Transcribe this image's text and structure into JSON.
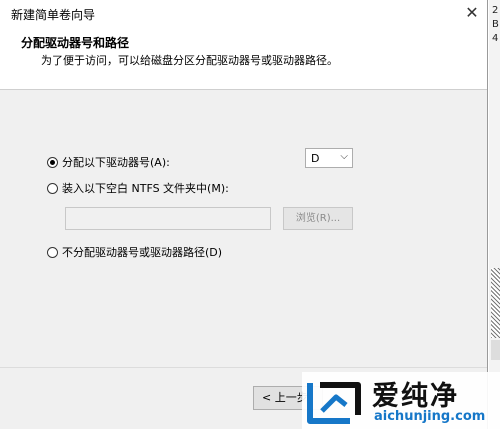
{
  "window": {
    "title": "新建简单卷向导",
    "close_glyph": "✕"
  },
  "header": {
    "title": "分配驱动器号和路径",
    "subtitle": "为了便于访问，可以给磁盘分区分配驱动器号或驱动器路径。"
  },
  "options": {
    "assign_letter": {
      "label": "分配以下驱动器号(A):",
      "checked": true
    },
    "mount_folder": {
      "label": "装入以下空白 NTFS 文件夹中(M):",
      "checked": false
    },
    "no_assign": {
      "label": "不分配驱动器号或驱动器路径(D)",
      "checked": false
    }
  },
  "drive_select": {
    "value": "D",
    "arrow_glyph": "⌵"
  },
  "path_input": {
    "value": ""
  },
  "browse_button": {
    "label": "浏览(R)..."
  },
  "footer": {
    "back_label": "< 上一步"
  },
  "background": {
    "text_1": "2",
    "text_2": "B",
    "text_3": "4"
  },
  "watermark": {
    "brand": "爱纯净",
    "url": "aichunjing.com"
  },
  "colors": {
    "body_bg": "#f0f0f0",
    "watermark_url": "#1677c8"
  }
}
